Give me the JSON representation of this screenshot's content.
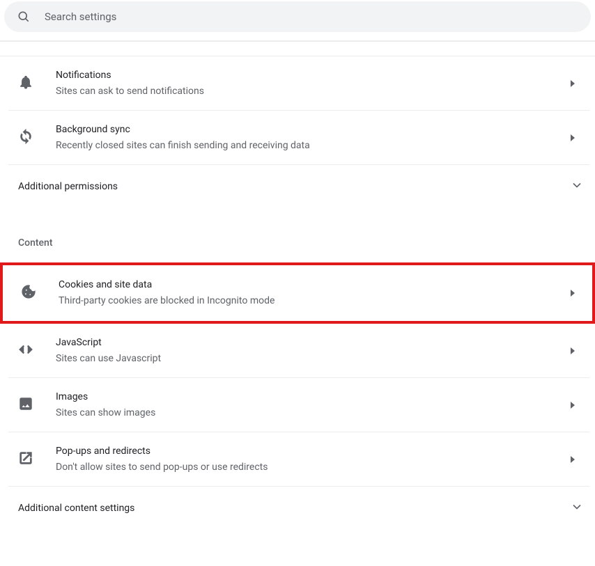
{
  "search": {
    "placeholder": "Search settings"
  },
  "permissions": {
    "notifications": {
      "title": "Notifications",
      "subtitle": "Sites can ask to send notifications"
    },
    "background_sync": {
      "title": "Background sync",
      "subtitle": "Recently closed sites can finish sending and receiving data"
    },
    "additional": "Additional permissions"
  },
  "content": {
    "header": "Content",
    "cookies": {
      "title": "Cookies and site data",
      "subtitle": "Third-party cookies are blocked in Incognito mode"
    },
    "javascript": {
      "title": "JavaScript",
      "subtitle": "Sites can use Javascript"
    },
    "images": {
      "title": "Images",
      "subtitle": "Sites can show images"
    },
    "popups": {
      "title": "Pop-ups and redirects",
      "subtitle": "Don't allow sites to send pop-ups or use redirects"
    },
    "additional": "Additional content settings"
  }
}
